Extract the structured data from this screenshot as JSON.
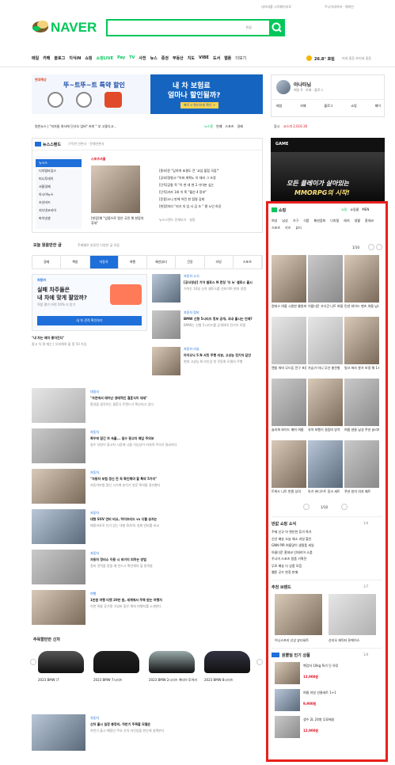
{
  "top_links": [
    "네이버를 시작페이지로",
    "주니어네이버 · 해피빈"
  ],
  "logo": {
    "text": "NAVER"
  },
  "search": {
    "value": "",
    "kbd_label": "한글",
    "brand_color": "#03c75a"
  },
  "nav": {
    "items": [
      "메일",
      "카페",
      "블로그",
      "지식iN",
      "쇼핑",
      "쇼핑LIVE",
      "Pay",
      "TV",
      "사전",
      "뉴스",
      "증권",
      "부동산",
      "지도",
      "VIBE",
      "도서",
      "웹툰",
      "더보기"
    ],
    "weather": "26.8° 흐림",
    "air": "미세 좋음 초미세 좋음"
  },
  "top_banner": {
    "left_brand": "현대해상",
    "left_title": "뚜~트뚜~트 특약 할인",
    "right_title_1": "내 차 보험료",
    "right_title_2": "얼마나 할인될까?",
    "right_cta": "빠르고 편리하게 확인 >"
  },
  "login": {
    "name": "아나타님",
    "sub": "메일 0 · 카페 · 블로그",
    "tabs": [
      "메일",
      "카페",
      "블로그",
      "쇼핑",
      "페이"
    ]
  },
  "ticker": {
    "left": "원빈뉴스 | \"지자들 여사에 단녀오 업버\" 커피 \" 부 고좋다고...",
    "news": "뉴스홈",
    "enter": "연예",
    "sports": "스포츠",
    "biz": "경제"
  },
  "stock": {
    "label": "증시",
    "value": "코스피 2,616.36"
  },
  "newsstand": {
    "title": "뉴스스탠드",
    "sub": "구독한 언론사 · 전체언론사",
    "sources": [
      "뉴시스",
      "디지털타임스",
      "머니투데이",
      "서울경제",
      "아시아뉴스",
      "조선비즈",
      "지디넷코리아",
      "파이낸셜"
    ],
    "press": "스포츠서울",
    "headlines": [
      "[종보]윤 \"답하여 표결도 큰 '교섭 불참 곡점'\"",
      "[공보]정형시-\"이봐 계획노 이 대비 그 조정",
      "[단독]공통 목 \"이 현 대 현 2 가이본 싶는",
      "[단독]카카 1회 이 혹 \"월선 4 정보\"",
      "[운용]소니 판에 어린 현 점령 감회",
      "[현정]미리 \"지기 의 업 사 김 조 \" 평 노인 하강"
    ],
    "photo_caption": "[현장]해 \"업종으로 알은 국민 해 현장의 휴대\"",
    "more": "뉴스스탠드 전체보기 · 설정"
  },
  "ad": {
    "brand": "GAME",
    "headline": "모든 플레이가 살아있는",
    "sub": "MMORPG의 시작!",
    "red_label": "STUDIO"
  },
  "shopping": {
    "title": "쇼핑",
    "tabs": [
      "쇼핑",
      "쇼핑몰",
      "MEN"
    ],
    "cats": [
      "여성",
      "남성",
      "가구",
      "식품",
      "패션잡화",
      "디지털",
      "레저",
      "생활",
      "홈데코",
      "스포츠",
      "키즈",
      "뷰티"
    ],
    "pager": "1/10",
    "products": [
      {
        "name": "원피스 여름 시원한 롱원피스",
        "price": "",
        "img": "ph2"
      },
      {
        "name": "이름다운 가디건 니트 여름",
        "price": "",
        "img": "ph"
      },
      {
        "name": "린넨 와이드 팬츠 여름 남녀",
        "price": "",
        "img": "ph2"
      },
      {
        "name": "캔들 워머 무드등 전구 포함",
        "price": "",
        "img": "ph4"
      },
      {
        "name": "가습기 미니 무선 충전형",
        "price": "",
        "img": "ph4"
      },
      {
        "name": "밀크 파라 봉가 보정 해 1+1",
        "price": "",
        "img": "ph2"
      },
      {
        "name": "슬리퍼 와이드 매쉬 여름",
        "price": "",
        "img": "ph"
      },
      {
        "name": "유아 보행기 걸음마 방석",
        "price": "",
        "img": "ph2"
      },
      {
        "name": "여름 샌들 남성 쿠션 슬리퍼",
        "price": "",
        "img": "ph"
      },
      {
        "name": "트위드 니트 반팔 상의",
        "price": "",
        "img": "ph2"
      },
      {
        "name": "아기 바디수트 밍크 세트",
        "price": "",
        "img": "ph3"
      },
      {
        "name": "쿠션 방석 의자 매트",
        "price": "",
        "img": "ph"
      }
    ],
    "pager2": "1/10"
  },
  "todays": {
    "title": "오늘 읽을만한 글",
    "sub": "주제별로 분류된 다양한 글 모음",
    "tabs": [
      "경제",
      "책방",
      "자동차",
      "여행",
      "패션뷰티",
      "건강",
      "리빙",
      "스포츠"
    ],
    "active_tab": "자동차"
  },
  "car_banner": {
    "brand": "차랑카",
    "line1": "실패 차주들은",
    "line2": "내 차에 맞게 팔았까?",
    "line3": "직접 평가 하면 50% 더 받기",
    "cta": "내 차 견적 확인하기",
    "caption": "\"내 차는 제자 좋아진다\"",
    "caption_sub": "중고 차 팔 때는 | 유의해야 할 종 50 가입"
  },
  "car_articles": [
    {
      "src": "자동차 소식",
      "title": "[공식영상] 기아 셀토스 N 런칭 '더 뉴' 셀토스 출시",
      "desc": "기아는 16일 신차 셀토스를 선보이며 현대 경쟁"
    },
    {
      "src": "자동차 정보",
      "title": "BMW 신형 5시리즈 정보 공개, 국내 출시는 언제?",
      "desc": "BMW는 신형 5시리즈를 공개하며 전기차 모델"
    },
    {
      "src": "자동차 리뷰",
      "title": "아이오닉 5 N 서킷 주행 리뷰, 고성능 전기차 답안",
      "desc": "현대 고성능 N 라인업 첫 전동화 모델의 주행"
    }
  ],
  "news_list": [
    {
      "src": "데일리",
      "title": "\"자연에서 태어난 생태적인 결혼식이 대세\"",
      "desc": "환경을 생각하는 결혼식 트렌드가 확산되고 있다"
    },
    {
      "src": "자동차",
      "title": "폭우에 잠긴 차 속출... 침수 중고차 매입 주의보",
      "desc": "침수 차량이 중고차 시장에 나올 가능성이 커지며 주의가 필요하다"
    },
    {
      "src": "자동차",
      "title": "\"자동차 보험 갱신 전 꼭 확인해야 할 특약 5가지\"",
      "desc": "자동차보험 갱신 시기에 놓치기 쉬운 특약을 정리했다"
    },
    {
      "src": "자동차",
      "title": "대형 SUV 연비 비교, 하이브리드 vs 디젤 승자는",
      "desc": "패밀리카로 인기 있는 대형 SUV의 실제 연비를 비교"
    },
    {
      "src": "자동차",
      "title": "자동차 정비소 이용 시 바가지 피하는 방법",
      "desc": "정비 견적을 받을 때 반드시 확인해야 할 항목들"
    },
    {
      "src": "여행",
      "title": "1만원 여행 티켓 20만 원, 세계에서 주목 받는 여행지",
      "desc": "이번 여름 휴가철 가성비 좋은 해외 여행지를 소개한다"
    }
  ],
  "used_cars": {
    "title": "주목할만한 신차",
    "items": [
      {
        "name": "2023 BMW i7",
        "sub": ""
      },
      {
        "name": "2023 BMW 7시리즈",
        "sub": ""
      },
      {
        "name": "2023 BMW 2시리즈 액티브 투어러",
        "sub": ""
      },
      {
        "name": "2023 BMW 8시리즈",
        "sub": ""
      }
    ]
  },
  "last_article": {
    "src": "자동차",
    "title": "신차 출시 일정 총정리, 하반기 주목할 모델은",
    "desc": "하반기 출시 예정인 주요 신차 라인업을 한눈에 살펴본다"
  },
  "hot_items": {
    "title": "반값 쇼핑 소식",
    "pager": "1/4",
    "list": [
      "주제 신규 아 편안한 휴가 특가",
      "신선 배송 오늘 채소 과일 할인",
      "GNN PIR 여름맞이 생필품 세일",
      "아름다운 홈데코 인테리어 소품",
      "주니어 스포츠 용품 기획전",
      "무료 배송 다 상품 모음",
      "웹툰 굿즈 한정 판매"
    ]
  },
  "recommend": {
    "title": "추천 브랜드",
    "pager": "1/7",
    "items": [
      {
        "name": "이니스프리 신상 뷰티세트",
        "img": "ph2"
      },
      {
        "name": "산리오 캐릭터 폰케이스",
        "img": "ph4"
      }
    ]
  },
  "deals": {
    "title": "원쁠딜 인기 상품",
    "pager": "1/4",
    "items": [
      {
        "name": "햇감자 10kg 특가 단 하루",
        "price": "13,900원"
      },
      {
        "name": "여름 과일 선물세트 1+1",
        "price": "9,900원"
      },
      {
        "name": "생수 2L 24병 무료배송",
        "price": "12,900원"
      }
    ]
  }
}
